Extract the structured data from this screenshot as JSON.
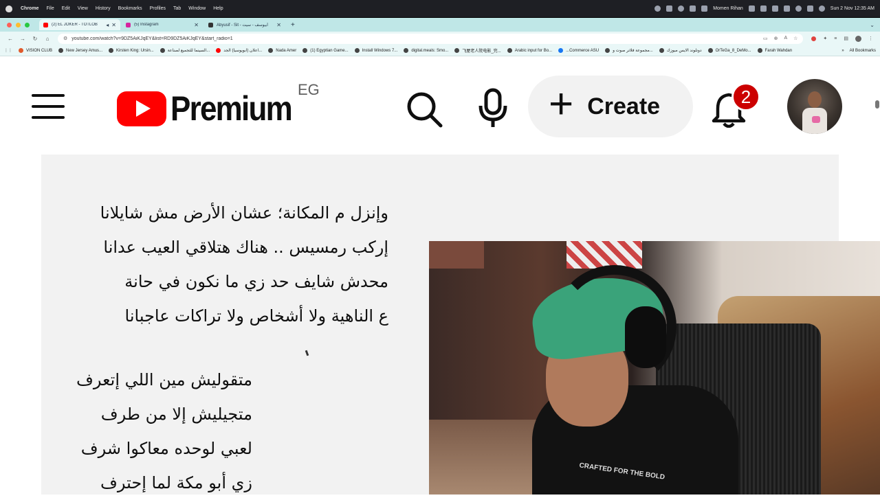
{
  "menubar": {
    "app": "Chrome",
    "items": [
      "File",
      "Edit",
      "View",
      "History",
      "Bookmarks",
      "Profiles",
      "Tab",
      "Window",
      "Help"
    ],
    "user": "Momen Rihan",
    "datetime": "Sun 2 Nov  12:35 AM"
  },
  "tabs": [
    {
      "label": "(2) EL JOKER - TOTLOB",
      "active": true,
      "color": "#ff0000"
    },
    {
      "label": "(5) Instagram",
      "active": false,
      "color": "#d6249f"
    },
    {
      "label": "Abyusif - Sit - أبيوسف - سيت",
      "active": false,
      "color": "#333333"
    }
  ],
  "address": {
    "url": "youtube.com/watch?v=9DZ5AiKJqEY&list=RD9DZ5AiKJqEY&start_radio=1"
  },
  "bookmarks": [
    {
      "label": "VISION CLUB",
      "color": "#e05a2b"
    },
    {
      "label": "New Jersey Amus...",
      "color": "#444444"
    },
    {
      "label": "Kirsten King: Ursin...",
      "color": "#444444"
    },
    {
      "label": "السينما للتجميع لصناعة...",
      "color": "#444444"
    },
    {
      "label": "اعلان (ابويوسيا) الجد...",
      "color": "#ff0000"
    },
    {
      "label": "Nada Amer",
      "color": "#444444"
    },
    {
      "label": "(1) Egyptian Game...",
      "color": "#444444"
    },
    {
      "label": "Install Windows 7...",
      "color": "#444444"
    },
    {
      "label": "digital.meals: Smo...",
      "color": "#444444"
    },
    {
      "label": "飞屋老人院电影_完...",
      "color": "#444444"
    },
    {
      "label": "Arabic input for Bo...",
      "color": "#444444"
    },
    {
      "label": "...Commerce ASU",
      "color": "#1877f2"
    },
    {
      "label": "مجموعة فلاتر صوت و...",
      "color": "#444444"
    },
    {
      "label": "دونلوند الايس ميوزك",
      "color": "#444444"
    },
    {
      "label": "OrTeGa_8_DeMo...",
      "color": "#444444"
    },
    {
      "label": "Farah Wahdan",
      "color": "#444444"
    }
  ],
  "bookmarks_all": "All Bookmarks",
  "youtube": {
    "brand": "Premium",
    "country": "EG",
    "create_label": "Create",
    "notification_count": "2"
  },
  "lyrics": {
    "stanza1": [
      "وإنزل م المكانة؛ عشان الأرض مش شايلانا",
      "إركب رمسيس .. هناك هتلاقي العيب عدانا",
      "محدش شايف حد زي ما نكون في حانة",
      "ع الناهية ولا أشخاص ولا تراكات عاجبانا"
    ],
    "stanza2": [
      "متقوليش مين اللي إتعرف",
      "متجيليش إلا من طرف",
      "لعبي لوحده معاكوا شرف",
      "زي أبو مكة لما إحترف"
    ]
  },
  "webcam": {
    "shirt_text": "CRAFTED FOR THE BOLD"
  },
  "colors": {
    "youtube_red": "#ff0000",
    "badge_red": "#cc0000",
    "tab_strip": "#bfe7e7"
  }
}
